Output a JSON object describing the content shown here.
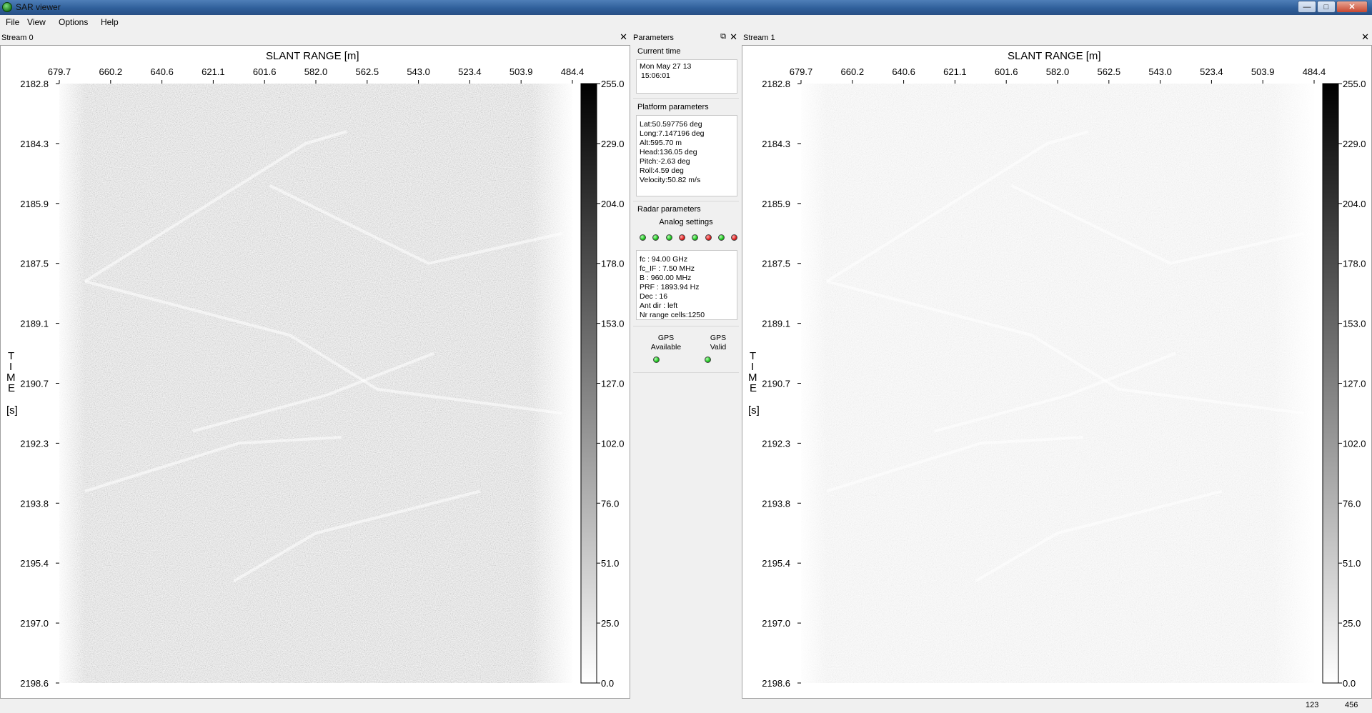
{
  "window": {
    "title": "SAR viewer"
  },
  "menu": {
    "file": "File",
    "view": "View",
    "options": "Options",
    "help": "Help"
  },
  "stream0": {
    "title": "Stream 0",
    "x_axis_title": "SLANT RANGE [m]",
    "x_ticks": [
      "679.7",
      "660.2",
      "640.6",
      "621.1",
      "601.6",
      "582.0",
      "562.5",
      "543.0",
      "523.4",
      "503.9",
      "484.4"
    ],
    "y_axis_letters": [
      "T",
      "I",
      "M",
      "E"
    ],
    "y_unit": "[s]",
    "y_ticks": [
      "2182.8",
      "2184.3",
      "2185.9",
      "2187.5",
      "2189.1",
      "2190.7",
      "2192.3",
      "2193.8",
      "2195.4",
      "2197.0",
      "2198.6"
    ],
    "colorbar_ticks": [
      "255.0",
      "229.0",
      "204.0",
      "178.0",
      "153.0",
      "127.0",
      "102.0",
      "76.0",
      "51.0",
      "25.0",
      "0.0"
    ]
  },
  "stream1": {
    "title": "Stream 1",
    "x_axis_title": "SLANT RANGE [m]",
    "x_ticks": [
      "679.7",
      "660.2",
      "640.6",
      "621.1",
      "601.6",
      "582.0",
      "562.5",
      "543.0",
      "523.4",
      "503.9",
      "484.4"
    ],
    "y_axis_letters": [
      "T",
      "I",
      "M",
      "E"
    ],
    "y_unit": "[s]",
    "y_ticks": [
      "2182.8",
      "2184.3",
      "2185.9",
      "2187.5",
      "2189.1",
      "2190.7",
      "2192.3",
      "2193.8",
      "2195.4",
      "2197.0",
      "2198.6"
    ],
    "colorbar_ticks": [
      "255.0",
      "229.0",
      "204.0",
      "178.0",
      "153.0",
      "127.0",
      "102.0",
      "76.0",
      "51.0",
      "25.0",
      "0.0"
    ]
  },
  "parameters": {
    "panel_title": "Parameters",
    "current_time_title": "Current time",
    "current_time_line1": "Mon May 27 13",
    "current_time_line2": "15:06:01",
    "platform_title": "Platform parameters",
    "platform_lines": [
      "Lat:50.597756 deg",
      "Long:7.147196 deg",
      "Alt:595.70 m",
      "Head:136.05 deg",
      "Pitch:-2.63 deg",
      "Roll:4.59 deg",
      "Velocity:50.82 m/s"
    ],
    "radar_title": "Radar parameters",
    "analog_settings_label": "Analog settings",
    "analog_leds": [
      "green",
      "green",
      "green",
      "red",
      "green",
      "red",
      "green",
      "red"
    ],
    "radar_lines": [
      "fc : 94.00 GHz",
      "fc_IF : 7.50 MHz",
      "B : 960.00 MHz",
      "PRF : 1893.94 Hz",
      "Dec : 16",
      "Ant dir : left",
      "Nr range cells:1250"
    ],
    "gps_available_line1": "GPS",
    "gps_available_line2": "Available",
    "gps_valid_line1": "GPS",
    "gps_valid_line2": "Valid",
    "gps_available_state": "green",
    "gps_valid_state": "green"
  },
  "status": {
    "value_a": "123",
    "value_b": "456"
  }
}
